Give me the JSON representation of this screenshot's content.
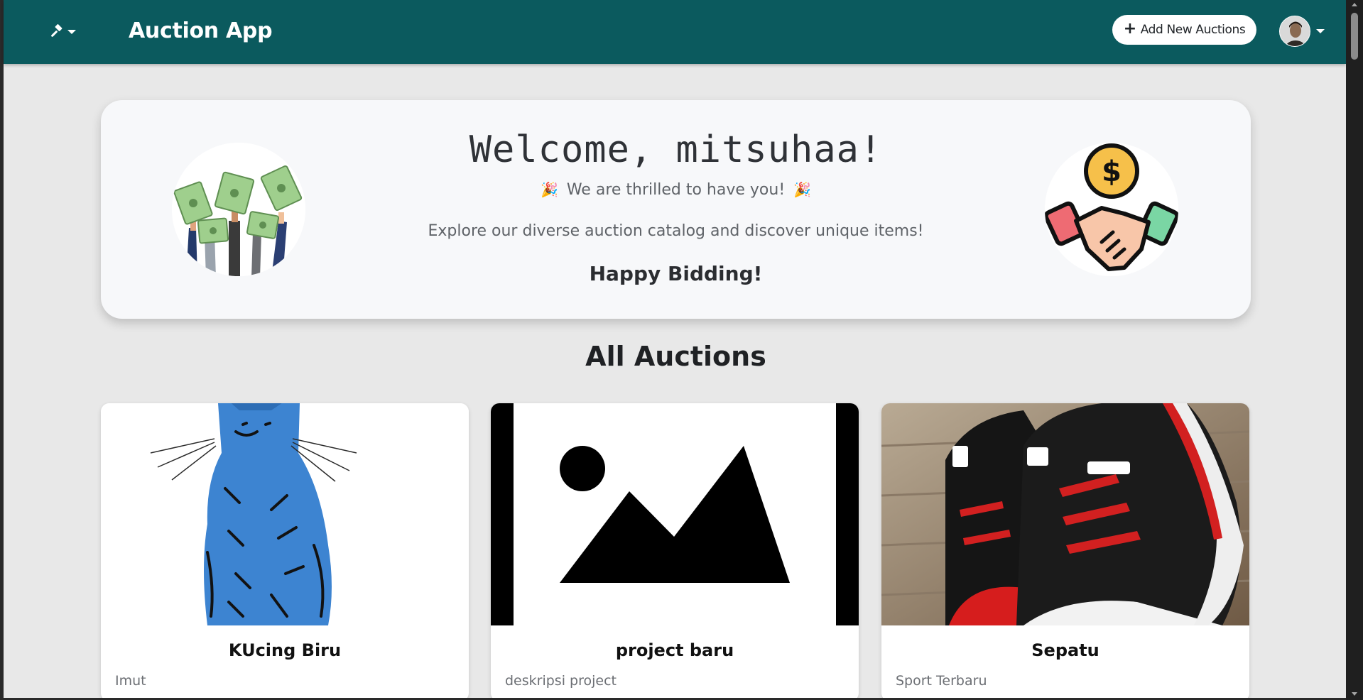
{
  "app": {
    "title": "Auction App",
    "brand_icon": "gavel-icon"
  },
  "navbar": {
    "add_button_icon": "+",
    "add_button_label": "Add New Auctions",
    "avatar_label": "user-avatar"
  },
  "welcome": {
    "title": "Welcome, mitsuhaa!",
    "subtitle": "We are thrilled to have you!",
    "party_icon_left": "🎉",
    "party_icon_right": "🎉",
    "explore_text": "Explore our diverse auction catalog and discover unique items!",
    "happy_text": "Happy Bidding!",
    "left_image": "money-hands-illustration",
    "right_image": "handshake-dollar-illustration"
  },
  "section": {
    "title": "All Auctions"
  },
  "auctions": [
    {
      "title": "KUcing Biru",
      "description": "Imut",
      "image": "blue-cat-painting"
    },
    {
      "title": "project baru",
      "description": "deskripsi project",
      "image": "image-placeholder-icon"
    },
    {
      "title": "Sepatu",
      "description": "Sport Terbaru",
      "image": "black-red-sneaker-photo"
    }
  ],
  "colors": {
    "navbar": "#0b5a5e",
    "page_bg": "#e8e8e8",
    "card_bg": "#ffffff",
    "welcome_bg": "#f7f8fa"
  }
}
